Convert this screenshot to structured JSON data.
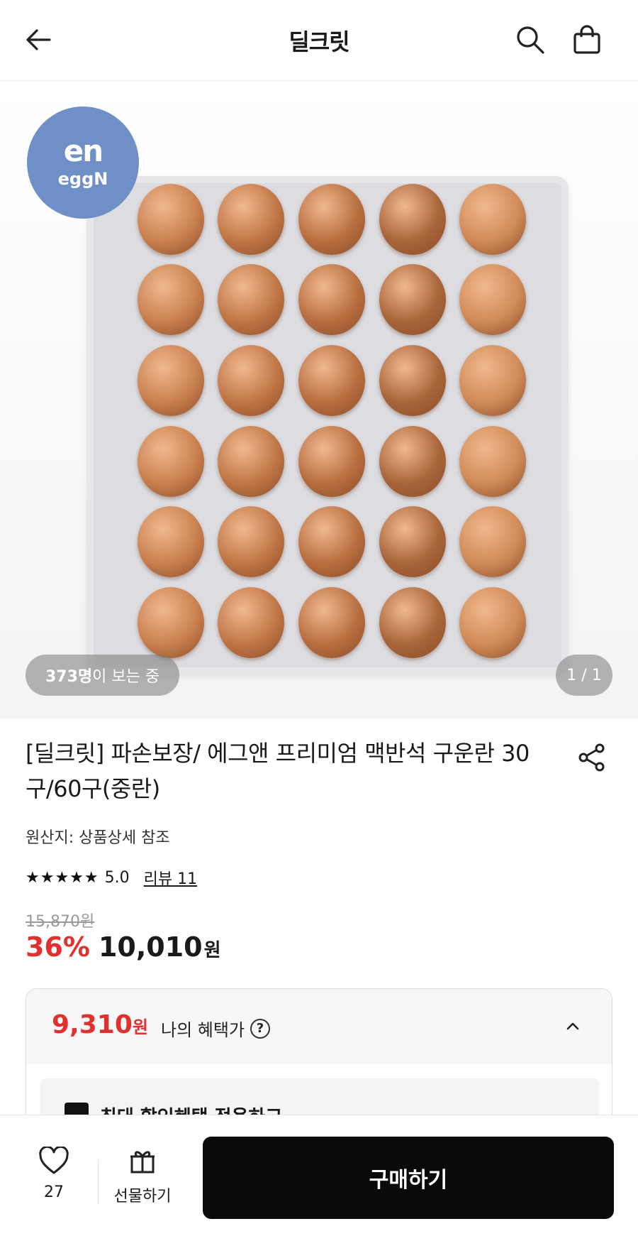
{
  "header": {
    "title": "딜크릿",
    "back_icon": "arrow-left-icon",
    "search_icon": "search-icon",
    "cart_icon": "shopping-bag-icon"
  },
  "hero": {
    "brand_mark": "en",
    "brand_name": "eggN",
    "viewers_count": "373명",
    "viewers_suffix": "이 보는 중",
    "pager": "1 / 1",
    "colors": {
      "badge": "#6f8fc7",
      "egg": "#c47a4a"
    }
  },
  "product": {
    "title": "[딜크릿] 파손보장/ 에그앤 프리미엄 맥반석 구운란 30구/60구(중란)",
    "origin": "원산지: 상품상세 참조",
    "stars": "★★★★★",
    "rating": "5.0",
    "review_label": "리뷰 11",
    "original_price": "15,870원",
    "discount": "36%",
    "sale_price": "10,010",
    "won": "원"
  },
  "benefit": {
    "price": "9,310",
    "won": "원",
    "label": "나의 혜택가",
    "help_icon": "question-circle-icon",
    "toggle_icon": "chevron-up-icon",
    "sub_text": "최대 할인혜택 적용하고"
  },
  "bottom_bar": {
    "like_count": "27",
    "gift_label": "선물하기",
    "buy_label": "구매하기",
    "accent": "#e0312f"
  }
}
